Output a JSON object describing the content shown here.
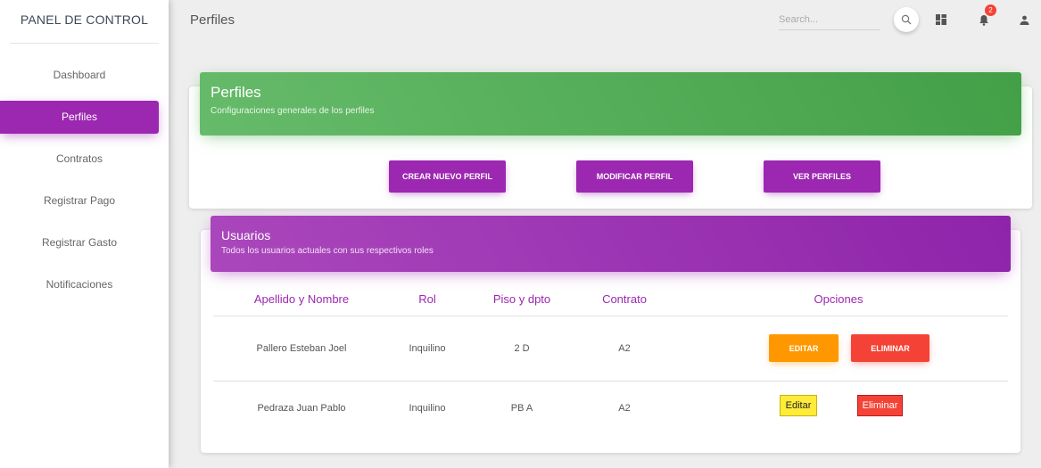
{
  "sidebar": {
    "brand": "PANEL DE CONTROL",
    "items": [
      {
        "label": "Dashboard"
      },
      {
        "label": "Perfiles"
      },
      {
        "label": "Contratos"
      },
      {
        "label": "Registrar Pago"
      },
      {
        "label": "Registrar Gasto"
      },
      {
        "label": "Notificaciones"
      }
    ],
    "active_index": 1
  },
  "topbar": {
    "title": "Perfiles",
    "search_placeholder": "Search...",
    "notifications_count": "2"
  },
  "profiles_card": {
    "title": "Perfiles",
    "subtitle": "Configuraciones generales de los perfiles",
    "buttons": {
      "create": "CREAR NUEVO PERFIL",
      "modify": "MODIFICAR PERFIL",
      "view": "VER PERFILES"
    }
  },
  "users_card": {
    "title": "Usuarios",
    "subtitle": "Todos los usuarios actuales con sus respectivos roles",
    "columns": [
      "Apellido y Nombre",
      "Rol",
      "Piso y dpto",
      "Contrato",
      "Opciones"
    ],
    "rows": [
      {
        "name": "Pallero Esteban Joel",
        "role": "Inquilino",
        "unit": "2 D",
        "contract": "A2",
        "edit_label": "EDITAR",
        "delete_label": "ELIMINAR"
      },
      {
        "name": "Pedraza Juan Pablo",
        "role": "Inquilino",
        "unit": "PB A",
        "contract": "A2",
        "edit_label": "Editar",
        "delete_label": "Eliminar"
      }
    ]
  },
  "colors": {
    "accent": "#9c27b0",
    "green": "#4caf50",
    "warning": "#ff9800",
    "danger": "#f44336",
    "yellow": "#ffeb3b"
  },
  "icons": [
    "search-icon",
    "dashboard-icon",
    "bell-icon",
    "person-icon"
  ]
}
